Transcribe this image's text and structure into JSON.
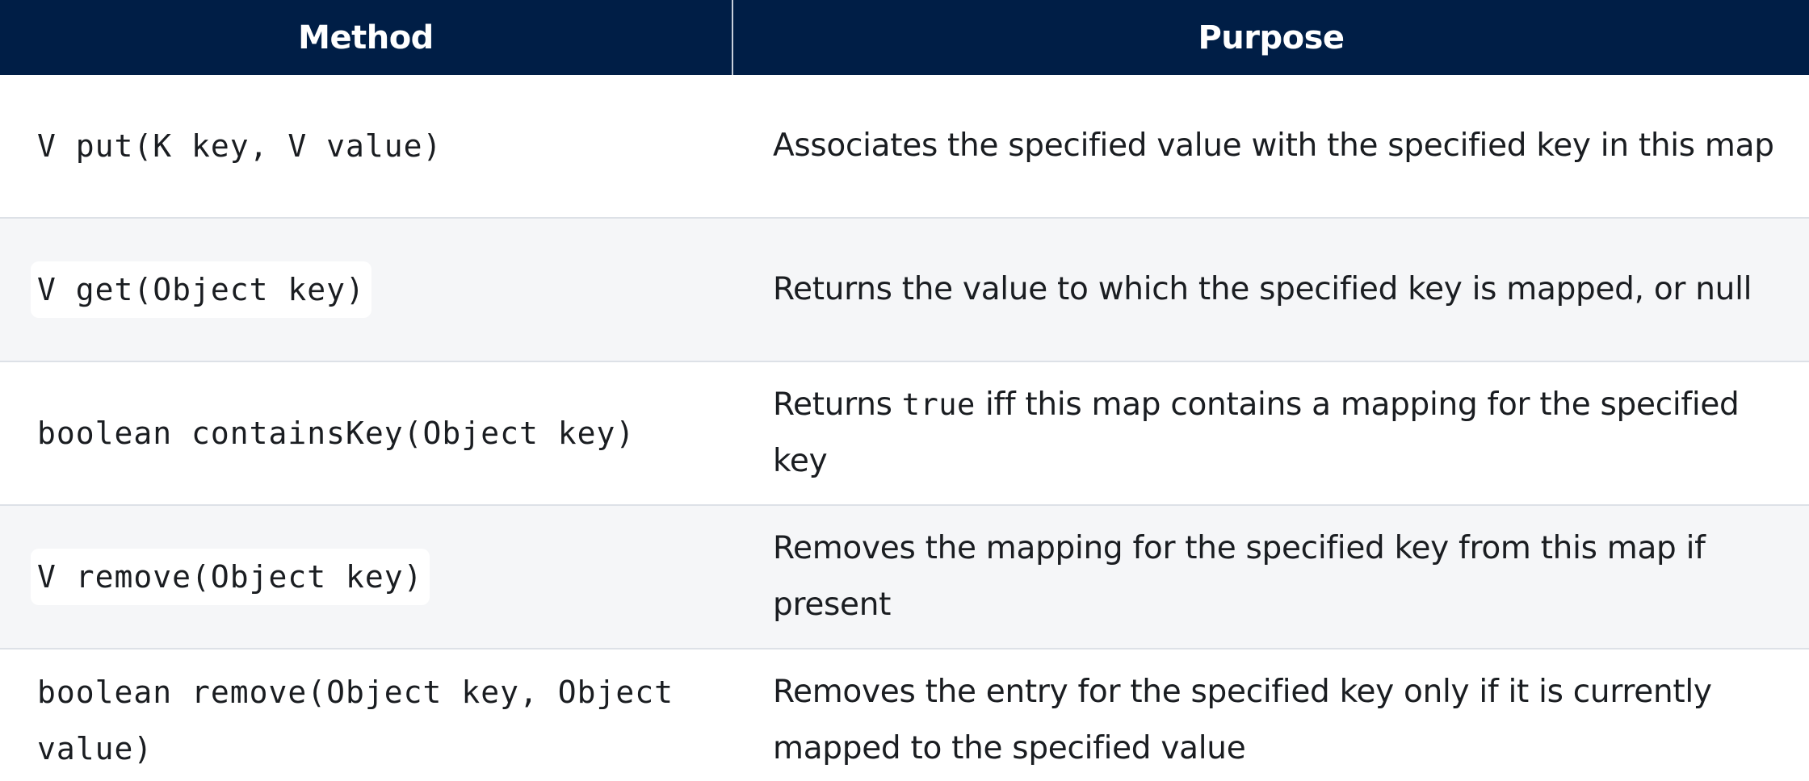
{
  "table": {
    "headers": {
      "method": "Method",
      "purpose": "Purpose"
    },
    "rows": [
      {
        "method": "V put(K key, V value)",
        "purpose": "Associates the specified value with the specified key in this map"
      },
      {
        "method": "V get(Object key)",
        "purpose": "Returns the value to which the specified key is mapped, or null"
      },
      {
        "method": "boolean containsKey(Object key)",
        "purpose_before": "Returns ",
        "purpose_code": "true",
        "purpose_after": " iff this map contains a mapping for the specified key"
      },
      {
        "method": "V remove(Object key)",
        "purpose": "Removes the mapping for the specified key from this map if present"
      },
      {
        "method": "boolean remove(Object key, Object value)",
        "purpose": "Removes the entry for the specified key only if it is currently mapped to the specified value"
      }
    ]
  },
  "colors": {
    "header_bg": "#001e46",
    "header_text": "#ffffff",
    "alt_row_bg": "#f5f6f8",
    "row_divider": "#dde1e7"
  }
}
